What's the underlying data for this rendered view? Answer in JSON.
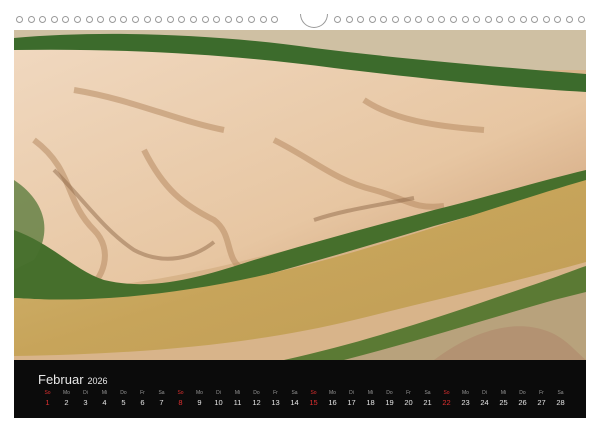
{
  "calendar": {
    "month": "Februar",
    "year": "2026",
    "days": [
      {
        "wd": "So",
        "n": "1",
        "sun": true
      },
      {
        "wd": "Mo",
        "n": "2"
      },
      {
        "wd": "Di",
        "n": "3"
      },
      {
        "wd": "Mi",
        "n": "4"
      },
      {
        "wd": "Do",
        "n": "5"
      },
      {
        "wd": "Fr",
        "n": "6"
      },
      {
        "wd": "Sa",
        "n": "7"
      },
      {
        "wd": "So",
        "n": "8",
        "sun": true
      },
      {
        "wd": "Mo",
        "n": "9"
      },
      {
        "wd": "Di",
        "n": "10"
      },
      {
        "wd": "Mi",
        "n": "11"
      },
      {
        "wd": "Do",
        "n": "12"
      },
      {
        "wd": "Fr",
        "n": "13"
      },
      {
        "wd": "Sa",
        "n": "14"
      },
      {
        "wd": "So",
        "n": "15",
        "sun": true
      },
      {
        "wd": "Mo",
        "n": "16"
      },
      {
        "wd": "Di",
        "n": "17"
      },
      {
        "wd": "Mi",
        "n": "18"
      },
      {
        "wd": "Do",
        "n": "19"
      },
      {
        "wd": "Fr",
        "n": "20"
      },
      {
        "wd": "Sa",
        "n": "21"
      },
      {
        "wd": "So",
        "n": "22",
        "sun": true
      },
      {
        "wd": "Mo",
        "n": "23"
      },
      {
        "wd": "Di",
        "n": "24"
      },
      {
        "wd": "Mi",
        "n": "25"
      },
      {
        "wd": "Do",
        "n": "26"
      },
      {
        "wd": "Fr",
        "n": "27"
      },
      {
        "wd": "Sa",
        "n": "28"
      }
    ]
  },
  "photo": {
    "subject": "aerial-river-tidal-flats"
  },
  "colors": {
    "sunday": "#e03030",
    "calendar_bg": "#0b0b0b",
    "river": "#c9a860",
    "vegetation": "#3f6b2a",
    "sand": "#e9c9a8"
  }
}
